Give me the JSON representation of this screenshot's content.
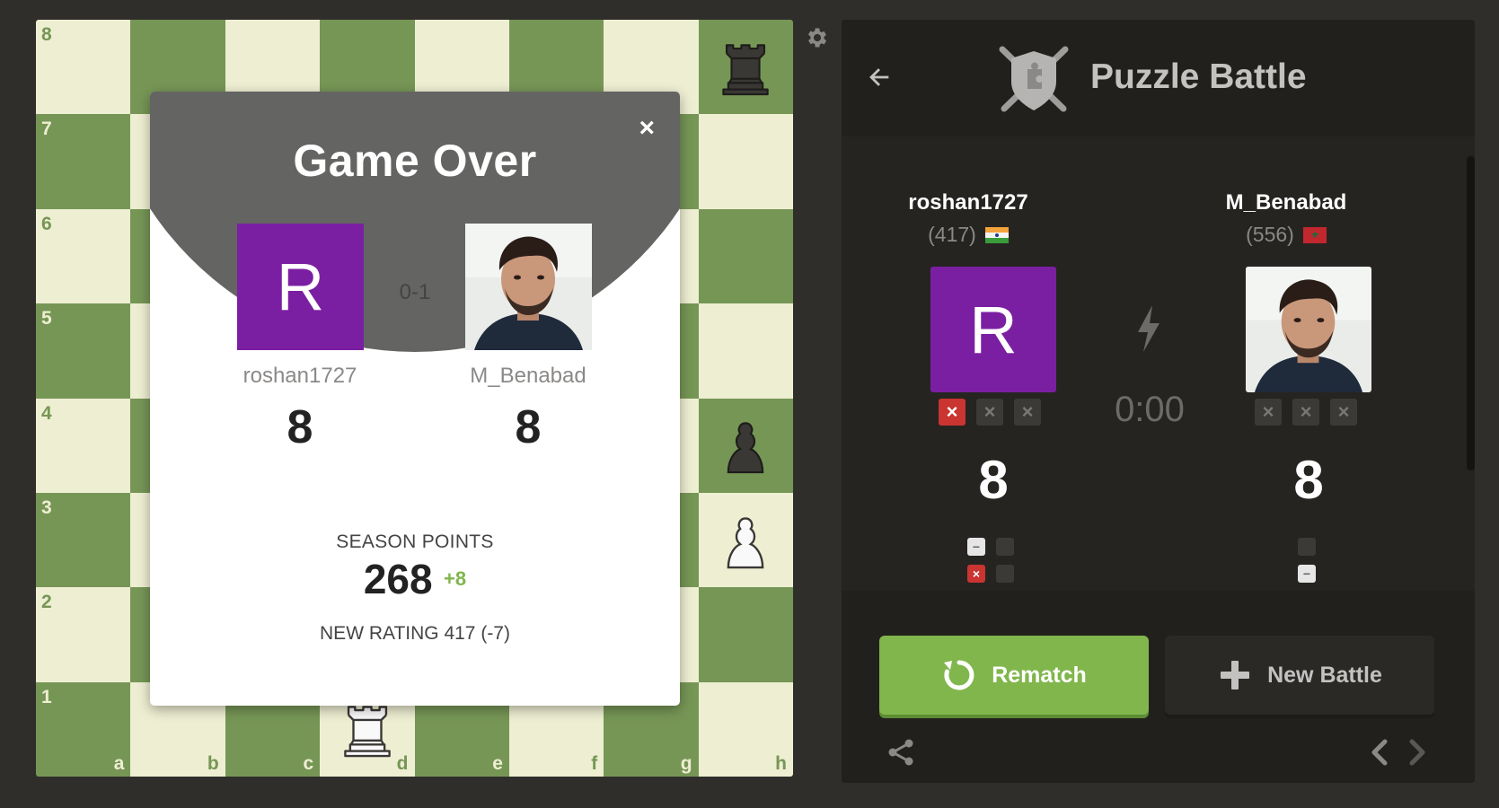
{
  "board": {
    "ranks": [
      "8",
      "7",
      "6",
      "5",
      "4",
      "3",
      "2",
      "1"
    ],
    "files": [
      "a",
      "b",
      "c",
      "d",
      "e",
      "f",
      "g",
      "h"
    ],
    "pieces": [
      {
        "square": "h8",
        "piece": "black-rook"
      },
      {
        "square": "h4",
        "piece": "black-pawn"
      },
      {
        "square": "h3",
        "piece": "white-pawn"
      },
      {
        "square": "d1",
        "piece": "white-rook"
      }
    ],
    "colors": {
      "light": "#eeeed2",
      "dark": "#769656"
    }
  },
  "modal": {
    "title": "Game Over",
    "close": "×",
    "score": "0-1",
    "left_player": {
      "name": "roshan1727",
      "avatar_letter": "R",
      "points": "8"
    },
    "right_player": {
      "name": "M_Benabad",
      "points": "8"
    },
    "season_label": "SEASON POINTS",
    "season_value": "268",
    "season_delta": "+8",
    "new_rating": "NEW RATING 417 (-7)"
  },
  "panel": {
    "title": "Puzzle Battle",
    "timer": "0:00",
    "left_player": {
      "name": "roshan1727",
      "rating": "(417)",
      "flag": "india-flag",
      "avatar_letter": "R",
      "score": "8",
      "strikes": [
        "×",
        "×",
        "×"
      ],
      "strikes_used": 1,
      "results": [
        "skip",
        "empty",
        "wrong",
        "empty",
        "right",
        "empty"
      ]
    },
    "right_player": {
      "name": "M_Benabad",
      "rating": "(556)",
      "flag": "morocco-flag",
      "score": "8",
      "strikes": [
        "×",
        "×",
        "×"
      ],
      "strikes_used": 0,
      "results": [
        "empty",
        "skip",
        "right"
      ]
    },
    "rematch_label": "Rematch",
    "new_battle_label": "New Battle",
    "accent": "#81b64c"
  }
}
